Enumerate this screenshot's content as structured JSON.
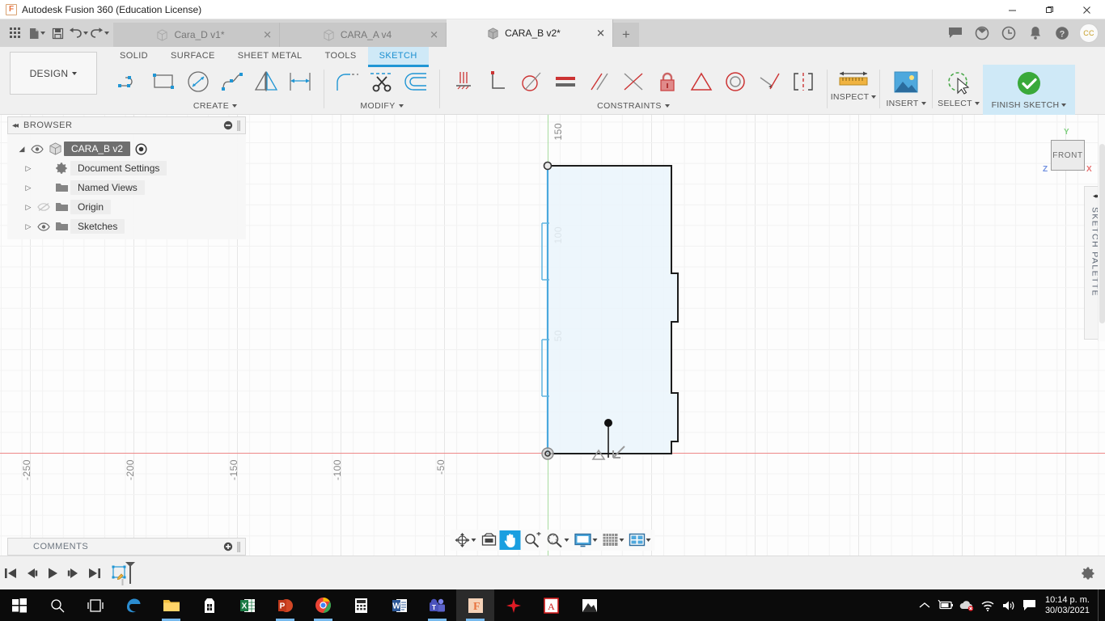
{
  "window": {
    "title": "Autodesk Fusion 360 (Education License)",
    "minimize": "—",
    "maximize": "❐",
    "close": "✕"
  },
  "quick_access": {
    "grid_label": "app-grid",
    "new_label": "new-document",
    "save_label": "save",
    "undo_label": "undo",
    "redo_label": "redo"
  },
  "tabs": [
    {
      "label": "Cara_D v1*",
      "active": false,
      "close": "✕"
    },
    {
      "label": "CARA_A v4",
      "active": false,
      "close": "✕"
    },
    {
      "label": "CARA_B v2*",
      "active": true,
      "close": "✕"
    }
  ],
  "tab_add": "+",
  "tab_right_icons": [
    "comments-icon",
    "job-status-icon",
    "recent-icon",
    "notifications-icon",
    "help-icon"
  ],
  "account": {
    "initials": "CC"
  },
  "ribbon": {
    "workspace": "DESIGN",
    "workspace_tabs": [
      {
        "label": "SOLID",
        "active": false
      },
      {
        "label": "SURFACE",
        "active": false
      },
      {
        "label": "SHEET METAL",
        "active": false
      },
      {
        "label": "TOOLS",
        "active": false
      },
      {
        "label": "SKETCH",
        "active": true
      }
    ],
    "panels": [
      {
        "label": "CREATE",
        "has_caret": true,
        "tools": [
          "line-icon",
          "rectangle-icon",
          "circle-icon",
          "spline-icon",
          "mirror-icon",
          "sketch-dimension-icon"
        ]
      },
      {
        "label": "MODIFY",
        "has_caret": true,
        "tools": [
          "fillet-icon",
          "trim-icon",
          "offset-icon"
        ]
      },
      {
        "label": "CONSTRAINTS",
        "has_caret": true,
        "tools": [
          "horizontal-vertical-icon",
          "perpendicular-icon",
          "tangent-arc-icon",
          "equal-icon",
          "parallel-icon",
          "midpoint-icon",
          "fix-lock-icon",
          "tangent-icon",
          "concentric-icon",
          "collinear-icon",
          "symmetry-icon"
        ]
      }
    ],
    "right_buttons": [
      {
        "label": "INSPECT",
        "icon": "measure-icon",
        "has_caret": true,
        "active": false
      },
      {
        "label": "INSERT",
        "icon": "insert-image-icon",
        "has_caret": true,
        "active": false
      },
      {
        "label": "SELECT",
        "icon": "select-cursor-icon",
        "has_caret": true,
        "active": false
      },
      {
        "label": "FINISH SKETCH",
        "icon": "finish-check-icon",
        "has_caret": true,
        "active": true
      }
    ]
  },
  "browser": {
    "header": "BROWSER",
    "collapse": "◂◂",
    "tree": [
      {
        "label": "CARA_B v2",
        "icon": "component-icon",
        "selected": true,
        "eye": true,
        "expander": "◢"
      },
      {
        "label": "Document Settings",
        "icon": "gear-icon",
        "selected": false,
        "eye": false,
        "expander": "▷"
      },
      {
        "label": "Named Views",
        "icon": "folder-icon",
        "selected": false,
        "eye": false,
        "expander": "▷"
      },
      {
        "label": "Origin",
        "icon": "folder-icon",
        "selected": false,
        "eye": true,
        "eye_off": true,
        "expander": "▷"
      },
      {
        "label": "Sketches",
        "icon": "folder-icon",
        "selected": false,
        "eye": true,
        "expander": "▷"
      }
    ]
  },
  "comments": {
    "label": "COMMENTS",
    "add": "⊕"
  },
  "sketch_palette": {
    "label": "SKETCH PALETTE",
    "collapse": "◂◂"
  },
  "viewcube": {
    "face": "FRONT",
    "axis_x": "X",
    "axis_y": "Y",
    "axis_z": "Z",
    "color_x": "#e87070",
    "color_y": "#7fd07f",
    "color_z": "#6f8fe0"
  },
  "canvas": {
    "x_ruler": [
      "-250",
      "-200",
      "-150",
      "-100",
      "-50"
    ],
    "y_ruler": [
      "150",
      "100",
      "50"
    ],
    "dimension_labels": [
      "150",
      "100",
      "50"
    ],
    "origin_marker": "origin-point",
    "constraints_shown": [
      "symmetry-constraint-icon",
      "midpoint-constraint-icon"
    ],
    "sketch_fill_color": "#eaf4fb",
    "sketch_line_color": "#1c1c1c",
    "axis_x_color": "#e08080",
    "axis_y_color": "#a8dca0"
  },
  "navbar": {
    "buttons": [
      {
        "name": "orbit-icon",
        "has_caret": true,
        "active": false
      },
      {
        "name": "look-at-icon",
        "has_caret": false,
        "active": false
      },
      {
        "name": "pan-icon",
        "has_caret": false,
        "active": true
      },
      {
        "name": "zoom-icon",
        "has_caret": false,
        "active": false
      },
      {
        "name": "fit-icon",
        "has_caret": true,
        "active": false
      },
      {
        "name": "display-settings-icon",
        "has_caret": true,
        "active": false
      },
      {
        "name": "grid-snaps-icon",
        "has_caret": true,
        "active": false
      },
      {
        "name": "viewports-icon",
        "has_caret": true,
        "active": false
      }
    ]
  },
  "timeline": {
    "buttons": [
      "skip-to-start-icon",
      "step-back-icon",
      "play-icon",
      "step-forward-icon",
      "skip-to-end-icon"
    ],
    "features": [
      "sketch-feature-icon"
    ],
    "settings": "timeline-settings-icon"
  },
  "taskbar": {
    "items": [
      {
        "name": "start-button",
        "running": false
      },
      {
        "name": "search-icon",
        "running": false
      },
      {
        "name": "task-view-icon",
        "running": false
      },
      {
        "name": "edge-icon",
        "running": false
      },
      {
        "name": "file-explorer-icon",
        "running": true
      },
      {
        "name": "microsoft-store-icon",
        "running": false
      },
      {
        "name": "excel-icon",
        "running": false
      },
      {
        "name": "powerpoint-icon",
        "running": true
      },
      {
        "name": "chrome-icon",
        "running": true
      },
      {
        "name": "calculator-icon",
        "running": false
      },
      {
        "name": "word-icon",
        "running": false
      },
      {
        "name": "teams-icon",
        "running": true
      },
      {
        "name": "fusion360-icon",
        "running": true,
        "active": true
      },
      {
        "name": "fusion-team-icon",
        "running": false
      },
      {
        "name": "acrobat-reader-icon",
        "running": false
      },
      {
        "name": "photos-icon",
        "running": false
      }
    ],
    "tray": [
      "show-hidden-icons",
      "battery-icon",
      "onedrive-offline-icon",
      "wifi-icon",
      "volume-icon",
      "action-center-icon"
    ],
    "clock": {
      "time": "10:14 p. m.",
      "date": "30/03/2021"
    }
  }
}
